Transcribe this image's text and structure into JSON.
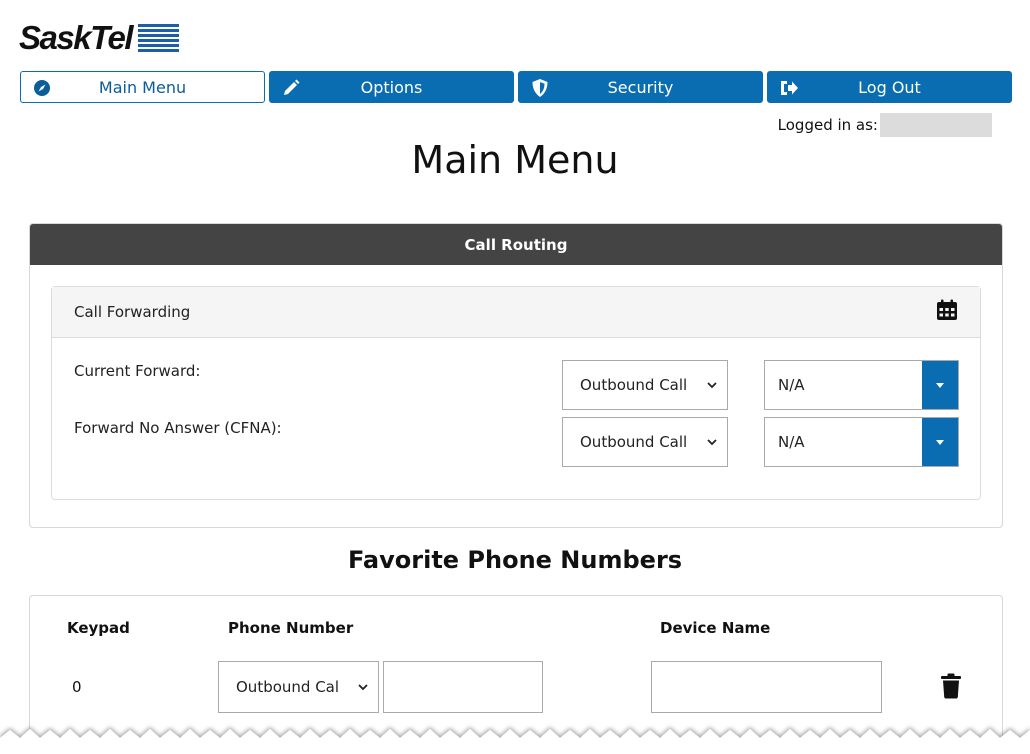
{
  "brand": {
    "logo_text": "SaskTel"
  },
  "nav": [
    {
      "label": "Main Menu",
      "icon": "compass-icon",
      "active": true
    },
    {
      "label": "Options",
      "icon": "pencil-icon",
      "active": false
    },
    {
      "label": "Security",
      "icon": "shield-icon",
      "active": false
    },
    {
      "label": "Log Out",
      "icon": "sign-out-icon",
      "active": false
    }
  ],
  "session": {
    "logged_in_label": "Logged in as:"
  },
  "page": {
    "title": "Main Menu"
  },
  "call_routing": {
    "header": "Call Routing",
    "forwarding": {
      "title": "Call Forwarding",
      "icon": "calendar-icon",
      "rows": [
        {
          "label": "Current Forward:",
          "type_value": "Outbound Call",
          "number_value": "N/A"
        },
        {
          "label": "Forward No Answer (CFNA):",
          "type_value": "Outbound Call",
          "number_value": "N/A"
        }
      ]
    }
  },
  "favorites": {
    "title": "Favorite Phone Numbers",
    "columns": {
      "keypad": "Keypad",
      "phone": "Phone Number",
      "device": "Device Name"
    },
    "rows": [
      {
        "keypad": "0",
        "type_value": "Outbound Cal",
        "number": "",
        "device": "",
        "icon": "trash-icon"
      }
    ]
  },
  "colors": {
    "primary": "#0a6db1",
    "header_dark": "#444444",
    "logo_blue": "#1d5ea8"
  }
}
